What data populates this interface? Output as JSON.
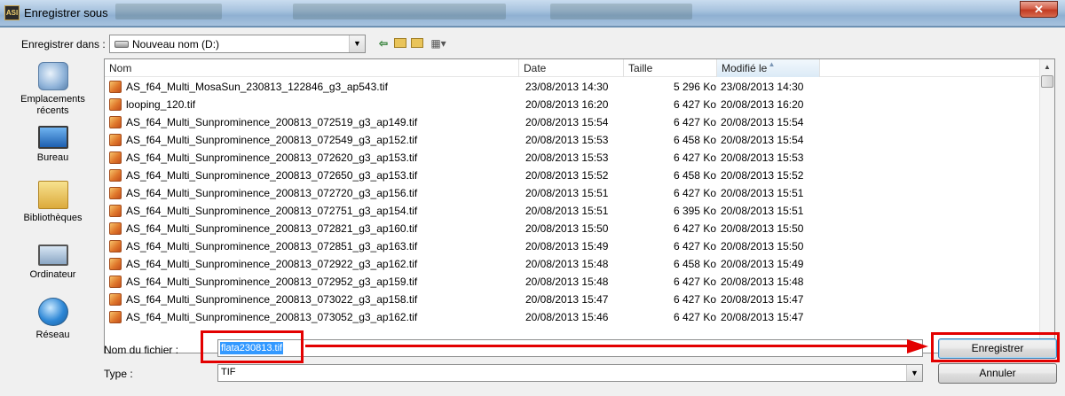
{
  "window": {
    "title": "Enregistrer sous",
    "app_icon_text": "ASI",
    "close_glyph": "✕"
  },
  "save_in": {
    "label": "Enregistrer dans :",
    "value": "Nouveau nom (D:)",
    "dropdown_glyph": "▼"
  },
  "toolbar": {
    "back_icon": "back-arrow-icon",
    "back_glyph": "⇦",
    "up_icon": "up-folder-icon",
    "new_folder_icon": "new-folder-icon",
    "view_icon": "view-menu-icon",
    "view_glyph": "▦▾"
  },
  "places": [
    {
      "label": "Emplacements récents",
      "icon": "recent-places-icon"
    },
    {
      "label": "Bureau",
      "icon": "desktop-icon"
    },
    {
      "label": "Bibliothèques",
      "icon": "libraries-icon"
    },
    {
      "label": "Ordinateur",
      "icon": "computer-icon"
    },
    {
      "label": "Réseau",
      "icon": "network-icon"
    }
  ],
  "columns": {
    "name": "Nom",
    "date": "Date",
    "size": "Taille",
    "modified": "Modifié le"
  },
  "files": [
    {
      "name": "AS_f64_Multi_MosaSun_230813_122846_g3_ap543.tif",
      "date": "23/08/2013 14:30",
      "size": "5 296 Ko",
      "modified": "23/08/2013 14:30"
    },
    {
      "name": "looping_120.tif",
      "date": "20/08/2013 16:20",
      "size": "6 427 Ko",
      "modified": "20/08/2013 16:20"
    },
    {
      "name": "AS_f64_Multi_Sunprominence_200813_072519_g3_ap149.tif",
      "date": "20/08/2013 15:54",
      "size": "6 427 Ko",
      "modified": "20/08/2013 15:54"
    },
    {
      "name": "AS_f64_Multi_Sunprominence_200813_072549_g3_ap152.tif",
      "date": "20/08/2013 15:53",
      "size": "6 458 Ko",
      "modified": "20/08/2013 15:54"
    },
    {
      "name": "AS_f64_Multi_Sunprominence_200813_072620_g3_ap153.tif",
      "date": "20/08/2013 15:53",
      "size": "6 427 Ko",
      "modified": "20/08/2013 15:53"
    },
    {
      "name": "AS_f64_Multi_Sunprominence_200813_072650_g3_ap153.tif",
      "date": "20/08/2013 15:52",
      "size": "6 458 Ko",
      "modified": "20/08/2013 15:52"
    },
    {
      "name": "AS_f64_Multi_Sunprominence_200813_072720_g3_ap156.tif",
      "date": "20/08/2013 15:51",
      "size": "6 427 Ko",
      "modified": "20/08/2013 15:51"
    },
    {
      "name": "AS_f64_Multi_Sunprominence_200813_072751_g3_ap154.tif",
      "date": "20/08/2013 15:51",
      "size": "6 395 Ko",
      "modified": "20/08/2013 15:51"
    },
    {
      "name": "AS_f64_Multi_Sunprominence_200813_072821_g3_ap160.tif",
      "date": "20/08/2013 15:50",
      "size": "6 427 Ko",
      "modified": "20/08/2013 15:50"
    },
    {
      "name": "AS_f64_Multi_Sunprominence_200813_072851_g3_ap163.tif",
      "date": "20/08/2013 15:49",
      "size": "6 427 Ko",
      "modified": "20/08/2013 15:50"
    },
    {
      "name": "AS_f64_Multi_Sunprominence_200813_072922_g3_ap162.tif",
      "date": "20/08/2013 15:48",
      "size": "6 458 Ko",
      "modified": "20/08/2013 15:49"
    },
    {
      "name": "AS_f64_Multi_Sunprominence_200813_072952_g3_ap159.tif",
      "date": "20/08/2013 15:48",
      "size": "6 427 Ko",
      "modified": "20/08/2013 15:48"
    },
    {
      "name": "AS_f64_Multi_Sunprominence_200813_073022_g3_ap158.tif",
      "date": "20/08/2013 15:47",
      "size": "6 427 Ko",
      "modified": "20/08/2013 15:47"
    },
    {
      "name": "AS_f64_Multi_Sunprominence_200813_073052_g3_ap162.tif",
      "date": "20/08/2013 15:46",
      "size": "6 427 Ko",
      "modified": "20/08/2013 15:47"
    }
  ],
  "filename": {
    "label": "Nom du fichier :",
    "value": "flata230813.tif"
  },
  "filetype": {
    "label": "Type :",
    "value": "TIF"
  },
  "buttons": {
    "save": "Enregistrer",
    "cancel": "Annuler"
  },
  "annotation_color": "#e30000"
}
